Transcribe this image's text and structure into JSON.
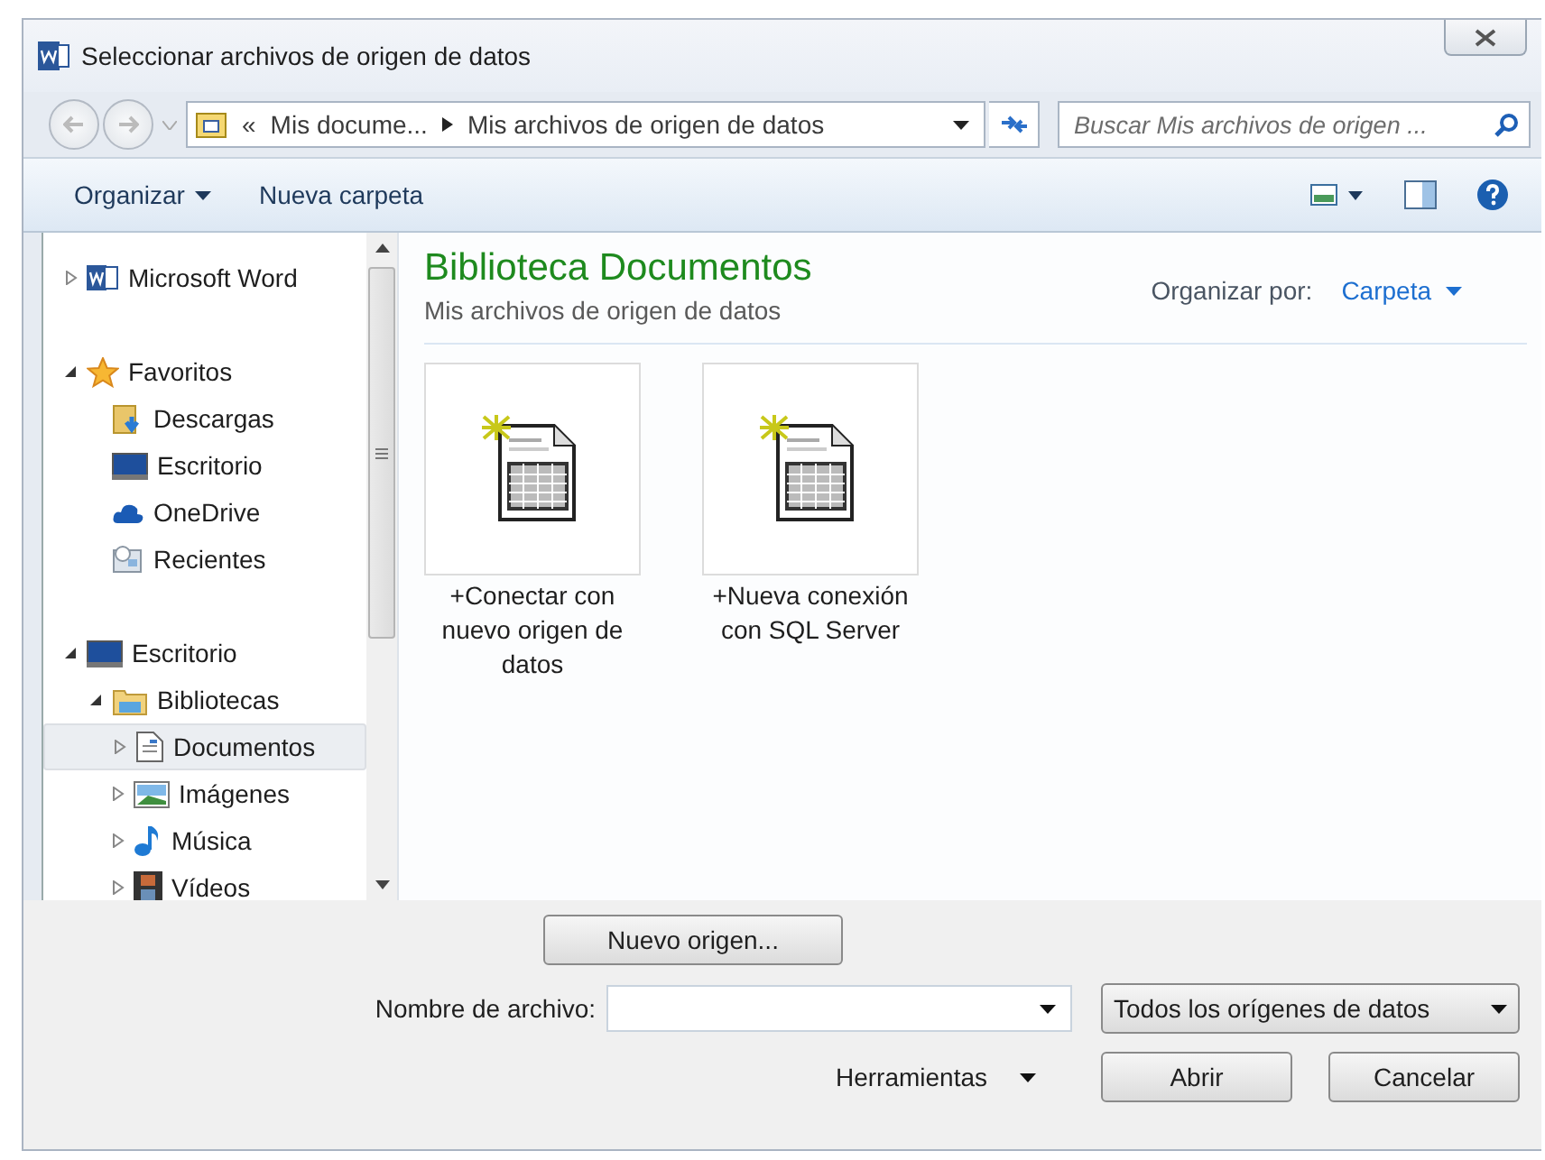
{
  "window": {
    "title": "Seleccionar archivos de origen de datos"
  },
  "address": {
    "overflow": "«",
    "crumbs": [
      "Mis docume...",
      "Mis archivos de origen de datos"
    ]
  },
  "search": {
    "placeholder": "Buscar Mis archivos de origen ..."
  },
  "toolbar": {
    "buttons": [
      "Organizar",
      "Nueva carpeta"
    ]
  },
  "tree": [
    {
      "label": "Microsoft Word",
      "expanded": false,
      "selected": false
    },
    {
      "label": "Favoritos",
      "expanded": true,
      "selected": false,
      "children": [
        {
          "label": "Descargas",
          "selected": false
        },
        {
          "label": "Escritorio",
          "selected": false
        },
        {
          "label": "OneDrive",
          "selected": false
        },
        {
          "label": "Recientes",
          "selected": false
        }
      ]
    },
    {
      "label": "Escritorio",
      "expanded": true,
      "selected": false,
      "children": [
        {
          "label": "Bibliotecas",
          "expanded": true,
          "selected": false,
          "children": [
            {
              "label": "Documentos",
              "expanded": false,
              "selected": true
            },
            {
              "label": "Imágenes",
              "expanded": false,
              "selected": false
            },
            {
              "label": "Música",
              "expanded": false,
              "selected": false
            },
            {
              "label": "Vídeos",
              "expanded": false,
              "selected": false
            }
          ]
        }
      ]
    }
  ],
  "library": {
    "title": "Biblioteca Documentos",
    "subtitle": "Mis archivos de origen de datos",
    "arrange_label": "Organizar por:",
    "arrange_value": "Carpeta"
  },
  "files": [
    {
      "label": "+Conectar con nuevo origen de datos"
    },
    {
      "label": "+Nueva conexión con SQL Server"
    }
  ],
  "new_source_button": "Nuevo origen...",
  "filename": {
    "label": "Nombre de archivo:"
  },
  "filter": "Todos los orígenes de datos",
  "tools": "Herramientas",
  "buttons": [
    "Abrir",
    "Cancelar"
  ]
}
